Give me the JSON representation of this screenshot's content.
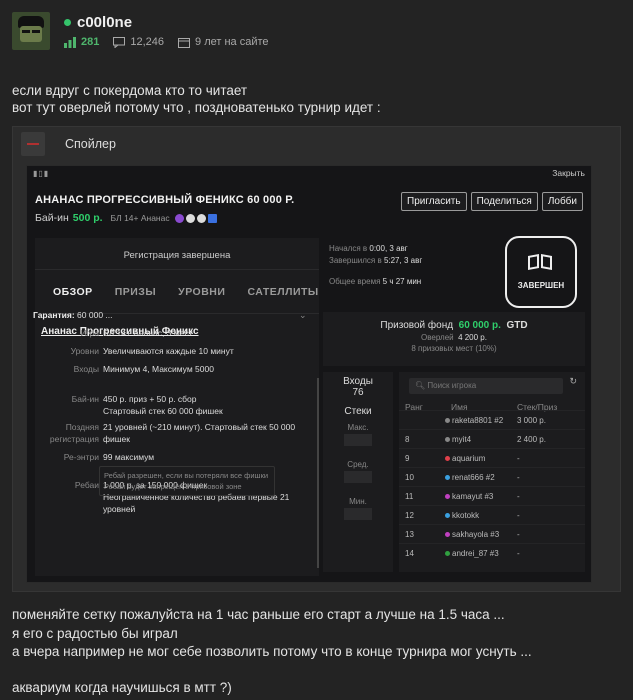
{
  "post": {
    "username": "c00l0ne",
    "reputation": "281",
    "messages": "12,246",
    "on_site": "9 лет на сайте",
    "intro_lines": [
      "если вдруг с покердома кто то читает",
      "вот тут оверлей потому что , поздноватенько турнир идет :"
    ],
    "spoiler_label": "Спойлер",
    "outro_lines": [
      "поменяйте сетку пожалуйста на 1 час раньше его старт а лучше на 1.5 часа ...",
      "я его с радостью бы играл",
      "а вчера например не мог себе позволить потому что в конце турнира мог уснуть ..."
    ],
    "last_line": "аквариум когда научишься в мтт ?)"
  },
  "tournament": {
    "close": "Закрыть",
    "title": "АНАНАС ПРОГРЕССИВНЫЙ ФЕНИКС 60 000 Р.",
    "buyin_label": "Бай-ин",
    "buyin_value": "500 р.",
    "buyin_tags": "БЛ 14+ Ананас",
    "buttons": [
      "Пригласить",
      "Поделиться",
      "Лобби"
    ],
    "registration": "Регистрация завершена",
    "tabs": [
      "ОБЗОР",
      "ПРИЗЫ",
      "УРОВНИ",
      "САТЕЛЛИТЫ"
    ],
    "name": "Ананас Прогрессивный Феникс",
    "guarantee_label": "Гарантия:",
    "guarantee_value": "60 000 ...",
    "rows": [
      {
        "k": "Игра",
        "v": "БЛ 14+ Ананас, 3 мест"
      },
      {
        "k": "Уровни",
        "v": "Увеличиваются каждые 10 минут"
      },
      {
        "k": "Входы",
        "v": "Минимум 4, Максимум 5000"
      },
      {
        "k": "Бай-ин",
        "v": "450 р. приз + 50 р. сбор"
      },
      {
        "k": "",
        "v": "Стартовый стек 60 000 фишек"
      },
      {
        "k": "Поздняя",
        "v": "21 уровней (~210 минут). Стартовый стек 50 000"
      },
      {
        "k": "регистрация",
        "v": "фишек"
      },
      {
        "k": "Ре-энтри",
        "v": "99 максимум"
      },
      {
        "k": "Ребаи",
        "v": "1 000 р. за 150 000 фишек"
      },
      {
        "k": "",
        "v": "Неограниченное количество ребаев первые 21"
      },
      {
        "k": "",
        "v": "уровней"
      }
    ],
    "rebuy_note": [
      "Ребай разрешен, если вы потеряли все фишки",
      "Ребай будет запрещён в призовой зоне"
    ],
    "started_label": "Начался в",
    "started_value": "0:00, 3 авг",
    "finished_label": "Завершился в",
    "finished_value": "5:27, 3 авг",
    "total_label": "Общее время",
    "total_value": "5 ч 27 мин",
    "done_label": "ЗАВЕРШЕН",
    "prize_label": "Призовой фонд",
    "prize_value": "60 000 р.",
    "prize_gtd": "GTD",
    "overlay_label": "Оверлей",
    "overlay_value": "4 200 р.",
    "paid_places": "8 призовых мест (10%)",
    "entries_label": "Входы",
    "entries_value": "76",
    "stacks_label": "Стеки",
    "stack_max": "Макс.",
    "stack_avg": "Сред.",
    "stack_min": "Мин.",
    "search_placeholder": "Поиск игрока",
    "col_rank": "Ранг",
    "col_name": "Имя",
    "col_stack": "Стек/Приз",
    "players": [
      {
        "rank": "",
        "name": "raketa8801 #2",
        "stack": "3 000 р.",
        "color": "#888888"
      },
      {
        "rank": "8",
        "name": "myit4",
        "stack": "2 400 р.",
        "color": "#888888"
      },
      {
        "rank": "9",
        "name": "aquarium",
        "stack": "-",
        "color": "#e0404a"
      },
      {
        "rank": "10",
        "name": "renat666 #2",
        "stack": "-",
        "color": "#3aa0e0"
      },
      {
        "rank": "11",
        "name": "kamayut #3",
        "stack": "-",
        "color": "#c040c0"
      },
      {
        "rank": "12",
        "name": "kkotokk",
        "stack": "-",
        "color": "#3aa0e0"
      },
      {
        "rank": "13",
        "name": "sakhayola #3",
        "stack": "-",
        "color": "#c040c0"
      },
      {
        "rank": "14",
        "name": "andrei_87 #3",
        "stack": "-",
        "color": "#30a040"
      }
    ]
  }
}
